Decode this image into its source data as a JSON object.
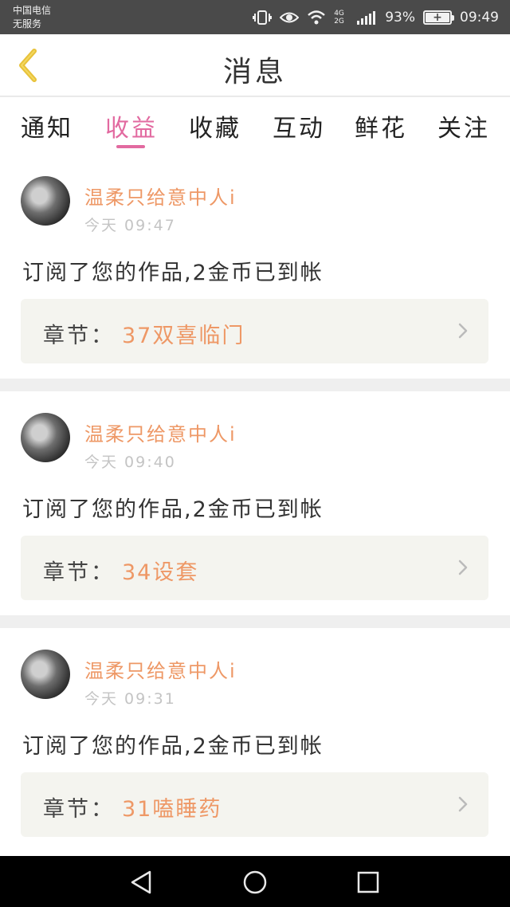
{
  "status_bar": {
    "carrier_line1": "中国电信",
    "carrier_line2": "无服务",
    "network_label": "4G 2G",
    "battery_percent": "93%",
    "time": "09:49",
    "icons": [
      "vibrate-icon",
      "eye-comfort-icon",
      "wifi-icon",
      "signal-icon",
      "battery-icon"
    ]
  },
  "header": {
    "title": "消息",
    "back_icon": "chevron-left-icon",
    "accent_color": "#e8c23a"
  },
  "tabs": [
    {
      "label": "通知",
      "active": false
    },
    {
      "label": "收益",
      "active": true
    },
    {
      "label": "收藏",
      "active": false
    },
    {
      "label": "互动",
      "active": false
    },
    {
      "label": "鲜花",
      "active": false
    },
    {
      "label": "关注",
      "active": false
    }
  ],
  "tab_active_color": "#e26aa0",
  "messages": [
    {
      "username": "温柔只给意中人i",
      "time": "今天 09:47",
      "text": "订阅了您的作品,2金币已到帐",
      "chapter_label": "章节：",
      "chapter_title": "37双喜临门"
    },
    {
      "username": "温柔只给意中人i",
      "time": "今天 09:40",
      "text": "订阅了您的作品,2金币已到帐",
      "chapter_label": "章节：",
      "chapter_title": "34设套"
    },
    {
      "username": "温柔只给意中人i",
      "time": "今天 09:31",
      "text": "订阅了您的作品,2金币已到帐",
      "chapter_label": "章节：",
      "chapter_title": "31嗑睡药"
    }
  ],
  "highlight_color": "#ee9866",
  "nav_bar": {
    "icons": [
      "back-triangle-icon",
      "home-circle-icon",
      "recents-square-icon"
    ]
  }
}
